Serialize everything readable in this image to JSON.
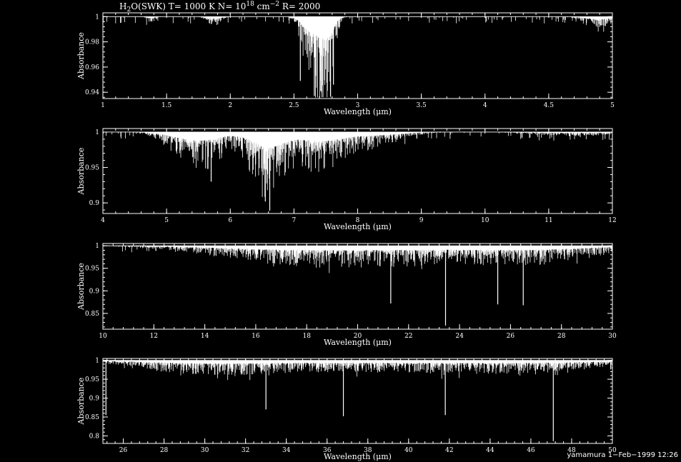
{
  "title": {
    "molecule": "H",
    "sub": "2",
    "after_sub": "O(SWK) T= 1000 K N= 10",
    "sup": "18",
    "after_sup": " cm",
    "sup2": "−2",
    "tail": " R= 2000"
  },
  "footer": "yamamura  1−Feb−1999 12:26",
  "colors": {
    "background": "#000000",
    "foreground": "#ffffff"
  },
  "chart_data": [
    {
      "type": "line",
      "xlabel": "Wavelength (μm)",
      "ylabel": "Absorbance",
      "xlim": [
        1,
        5
      ],
      "ylim": [
        0.935,
        1.003
      ],
      "xticks": [
        1,
        1.5,
        2,
        2.5,
        3,
        3.5,
        4,
        4.5,
        5
      ],
      "xtick_labels": [
        "1",
        "1.5",
        "2",
        "2.5",
        "3",
        "3.5",
        "4",
        "4.5",
        "5"
      ],
      "yticks": [
        0.94,
        0.96,
        0.98,
        1
      ],
      "ytick_labels": [
        "0.94",
        "0.96",
        "0.98",
        "1"
      ],
      "bands": [
        {
          "center": 1.38,
          "width": 0.05,
          "depth": 0.003
        },
        {
          "center": 1.87,
          "width": 0.07,
          "depth": 0.005
        },
        {
          "center": 2.62,
          "width": 0.08,
          "depth": 0.035
        },
        {
          "center": 2.72,
          "width": 0.07,
          "depth": 0.04
        },
        {
          "center": 2.78,
          "width": 0.06,
          "depth": 0.03
        },
        {
          "center": 4.9,
          "width": 0.15,
          "depth": 0.006
        }
      ],
      "deepest": [
        {
          "x": 2.66,
          "y": 0.937
        },
        {
          "x": 2.71,
          "y": 0.941
        },
        {
          "x": 2.55,
          "y": 0.949
        },
        {
          "x": 2.81,
          "y": 0.946
        }
      ]
    },
    {
      "type": "line",
      "xlabel": "Wavelength (μm)",
      "ylabel": "Absorbance",
      "xlim": [
        4,
        12
      ],
      "ylim": [
        0.885,
        1.005
      ],
      "xticks": [
        4,
        5,
        6,
        7,
        8,
        9,
        10,
        11,
        12
      ],
      "xtick_labels": [
        "4",
        "5",
        "6",
        "7",
        "8",
        "9",
        "10",
        "11",
        "12"
      ],
      "yticks": [
        0.9,
        0.95,
        1
      ],
      "ytick_labels": [
        "0.9",
        "0.95",
        "1"
      ],
      "bands": [
        {
          "center": 5.5,
          "width": 0.5,
          "depth": 0.04
        },
        {
          "center": 6.6,
          "width": 0.35,
          "depth": 0.07
        },
        {
          "center": 7.4,
          "width": 0.45,
          "depth": 0.04
        },
        {
          "center": 8.2,
          "width": 0.6,
          "depth": 0.015
        },
        {
          "center": 11.4,
          "width": 0.8,
          "depth": 0.004
        }
      ],
      "deepest": [
        {
          "x": 6.62,
          "y": 0.889
        },
        {
          "x": 6.55,
          "y": 0.902
        },
        {
          "x": 5.7,
          "y": 0.93
        }
      ]
    },
    {
      "type": "line",
      "xlabel": "Wavelength (μm)",
      "ylabel": "Absorbance",
      "xlim": [
        10,
        30
      ],
      "ylim": [
        0.815,
        1.005
      ],
      "xticks": [
        10,
        12,
        14,
        16,
        18,
        20,
        22,
        24,
        26,
        28,
        30
      ],
      "xtick_labels": [
        "10",
        "12",
        "14",
        "16",
        "18",
        "20",
        "22",
        "24",
        "26",
        "28",
        "30"
      ],
      "yticks": [
        0.85,
        0.9,
        0.95,
        1
      ],
      "ytick_labels": [
        "0.85",
        "0.9",
        "0.95",
        "1"
      ],
      "bands": [
        {
          "center": 17,
          "width": 4,
          "depth": 0.02
        },
        {
          "center": 22,
          "width": 5,
          "depth": 0.025
        },
        {
          "center": 27,
          "width": 3,
          "depth": 0.02
        }
      ],
      "deepest": [
        {
          "x": 23.45,
          "y": 0.823
        },
        {
          "x": 21.3,
          "y": 0.872
        },
        {
          "x": 25.5,
          "y": 0.87
        },
        {
          "x": 26.5,
          "y": 0.868
        }
      ]
    },
    {
      "type": "line",
      "xlabel": "Wavelength (μm)",
      "ylabel": "Absorbance",
      "xlim": [
        25,
        50
      ],
      "ylim": [
        0.78,
        1.005
      ],
      "xticks": [
        26,
        28,
        30,
        32,
        34,
        36,
        38,
        40,
        42,
        44,
        46,
        48,
        50
      ],
      "xtick_labels": [
        "26",
        "28",
        "30",
        "32",
        "34",
        "36",
        "38",
        "40",
        "42",
        "44",
        "46",
        "48",
        "50"
      ],
      "yticks": [
        0.8,
        0.85,
        0.9,
        0.95,
        1
      ],
      "ytick_labels": [
        "0.8",
        "0.85",
        "0.9",
        "0.95",
        "1"
      ],
      "bands": [
        {
          "center": 30,
          "width": 4,
          "depth": 0.02
        },
        {
          "center": 38,
          "width": 8,
          "depth": 0.02
        },
        {
          "center": 46,
          "width": 5,
          "depth": 0.015
        }
      ],
      "deepest": [
        {
          "x": 47.1,
          "y": 0.786
        },
        {
          "x": 36.8,
          "y": 0.852
        },
        {
          "x": 41.8,
          "y": 0.855
        },
        {
          "x": 33.0,
          "y": 0.87
        },
        {
          "x": 25.15,
          "y": 0.855
        }
      ]
    }
  ]
}
